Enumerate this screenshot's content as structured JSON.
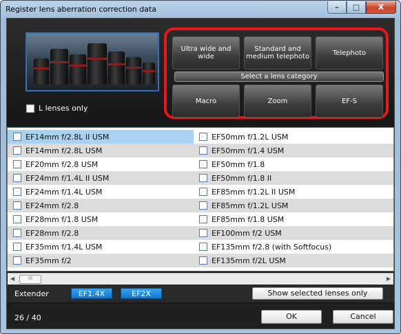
{
  "window": {
    "title": "Register lens aberration correction data",
    "controls": {
      "minimize": "–",
      "maximize": "□",
      "close": "X"
    }
  },
  "filter": {
    "l_lenses_label": "L lenses only"
  },
  "categories": {
    "label": "Select a lens category",
    "tiles": {
      "ultra_wide": "Ultra wide and wide",
      "standard": "Standard and medium telephoto",
      "telephoto": "Telephoto",
      "macro": "Macro",
      "zoom": "Zoom",
      "efs": "EF-S"
    }
  },
  "lenses": {
    "rows": [
      {
        "left": "EF14mm f/2.8L II USM",
        "right": "EF50mm f/1.2L USM"
      },
      {
        "left": "EF14mm f/2.8L USM",
        "right": "EF50mm f/1.4 USM"
      },
      {
        "left": "EF20mm f/2.8 USM",
        "right": "EF50mm f/1.8"
      },
      {
        "left": "EF24mm f/1.4L II USM",
        "right": "EF50mm f/1.8 II"
      },
      {
        "left": "EF24mm f/1.4L USM",
        "right": "EF85mm f/1.2L II USM"
      },
      {
        "left": "EF24mm f/2.8",
        "right": "EF85mm f/1.2L USM"
      },
      {
        "left": "EF28mm f/1.8 USM",
        "right": "EF85mm f/1.8 USM"
      },
      {
        "left": "EF28mm f/2.8",
        "right": "EF100mm f/2 USM"
      },
      {
        "left": "EF35mm f/1.4L USM",
        "right": "EF135mm f/2.8 (with Softfocus)"
      },
      {
        "left": "EF35mm f/2",
        "right": "EF135mm f/2L USM"
      }
    ],
    "scroll_thumb": "III"
  },
  "extender": {
    "label": "Extender",
    "ef14x": "EF1.4X",
    "ef2x": "EF2X",
    "show_selected": "Show selected lenses only"
  },
  "footer": {
    "count": "26 / 40",
    "ok": "OK",
    "cancel": "Cancel"
  }
}
